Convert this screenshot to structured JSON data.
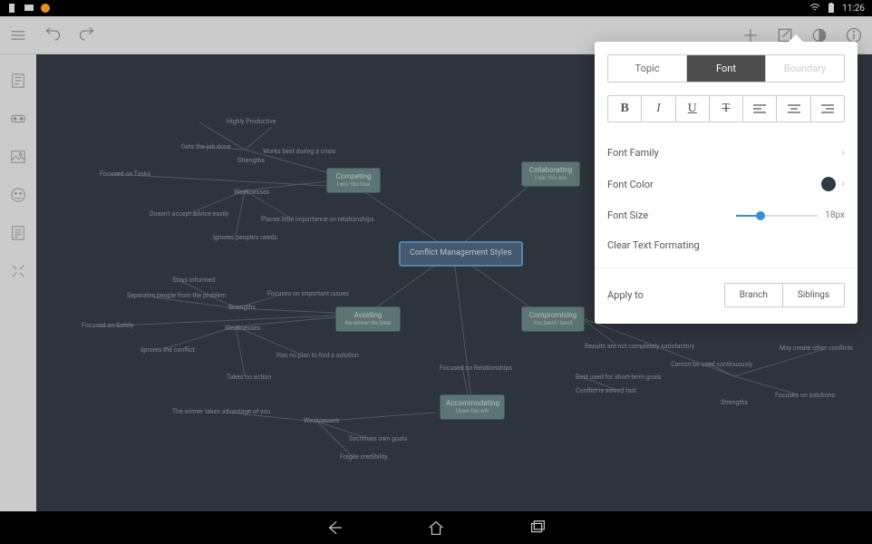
{
  "status": {
    "time": "11:26"
  },
  "toolbar": {
    "menu": "menu",
    "undo": "undo",
    "redo": "redo",
    "add": "add",
    "edit": "edit",
    "theme": "theme",
    "info": "info"
  },
  "side": [
    "notes",
    "relationship",
    "image",
    "markers",
    "attachment",
    "focus"
  ],
  "mindmap": {
    "central": "Conflict Management Styles",
    "nodes": {
      "competing": {
        "title": "Competing",
        "subtitle": "I win You lose"
      },
      "collaborating": {
        "title": "Collaborating",
        "subtitle": "I win You win"
      },
      "avoiding": {
        "title": "Avoiding",
        "subtitle": "No winner No loser"
      },
      "compromising": {
        "title": "Compromising",
        "subtitle": "You bend I bend"
      },
      "accommodating": {
        "title": "Accommodating",
        "subtitle": "I lose You win"
      }
    },
    "labels": {
      "highly_productive": "Highly Productive",
      "gets_job_done": "Gets the job done",
      "works_best": "Works best during a crisis",
      "strengths1": "Strengths",
      "weaknesses1": "Weaknesses",
      "focused_tasks": "Focused on Tasks",
      "doesnt_accept": "Doesn't accept advice easily",
      "places_little": "Places little importance on relationships",
      "ignores_needs": "Ignores people's needs",
      "stays_informed": "Stays informed",
      "separates": "Separates people from the problem",
      "focuses_important": "Focuses on important issues",
      "strengths2": "Strengths",
      "weaknesses2": "Weaknesses",
      "focused_safety": "Focused on Safety",
      "ignores_conflict": "Ignores the conflict",
      "no_plan": "Has no plan to find a solution",
      "takes_no_action": "Takes no action",
      "focused_relationships": "Focused on Relationships",
      "weaknesses3": "Weaknesses",
      "winner_advantage": "The winner takes advantage of you",
      "sacrifices": "Sacrifices own goals",
      "fragile": "Fragile credibility",
      "results_not": "Results are not completely satisfactory",
      "best_short": "Best used for short-term goals",
      "conflict_solved": "Conflict is solved fast",
      "strengths3": "Strengths",
      "may_create": "May create other conflicts",
      "cannot_used": "Cannot be used continuously",
      "focuses_solutions": "Focuses on solutions"
    }
  },
  "popover": {
    "tabs": {
      "topic": "Topic",
      "font": "Font",
      "boundary": "Boundary"
    },
    "font_family": "Font Family",
    "font_color": "Font Color",
    "font_size": "Font Size",
    "font_size_value": "18px",
    "clear": "Clear Text Formating",
    "apply_to": "Apply to",
    "branch": "Branch",
    "siblings": "Siblings"
  },
  "colors": {
    "swatch": "#2e3a45"
  }
}
